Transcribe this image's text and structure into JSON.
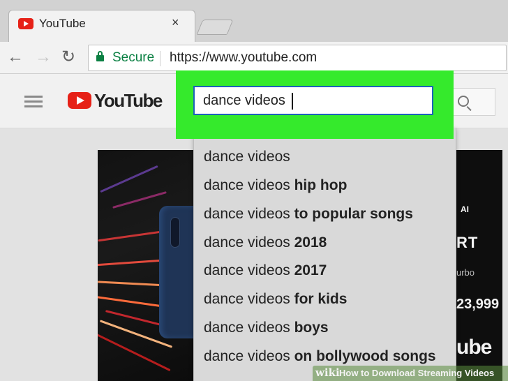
{
  "browser": {
    "tab": {
      "title": "YouTube",
      "close_glyph": "×"
    },
    "nav": {
      "back_glyph": "←",
      "forward_glyph": "→",
      "reload_glyph": "↻"
    },
    "address": {
      "security_label": "Secure",
      "url": "https://www.youtube.com"
    }
  },
  "youtube": {
    "logo_text": "YouTube",
    "search": {
      "value": "dance videos"
    },
    "suggestions": [
      {
        "base": "dance videos",
        "extra": ""
      },
      {
        "base": "dance videos ",
        "extra": "hip hop"
      },
      {
        "base": "dance videos ",
        "extra": "to popular songs"
      },
      {
        "base": "dance videos ",
        "extra": "2018"
      },
      {
        "base": "dance videos ",
        "extra": "2017"
      },
      {
        "base": "dance videos ",
        "extra": "for kids"
      },
      {
        "base": "dance videos ",
        "extra": "boys"
      },
      {
        "base": "dance videos ",
        "extra": "on bollywood songs"
      }
    ],
    "thumbnail_right": {
      "badge": "AI",
      "headline": "RT",
      "subline": "urbo",
      "price": "23,999",
      "brand": "ube"
    }
  },
  "watermark": {
    "wiki": "wiki",
    "title": "How to Download Streaming Videos"
  },
  "colors": {
    "highlight": "#35ea2c",
    "youtube_red": "#e62117",
    "secure_green": "#0b8043",
    "focus_blue": "#1c62b9"
  }
}
